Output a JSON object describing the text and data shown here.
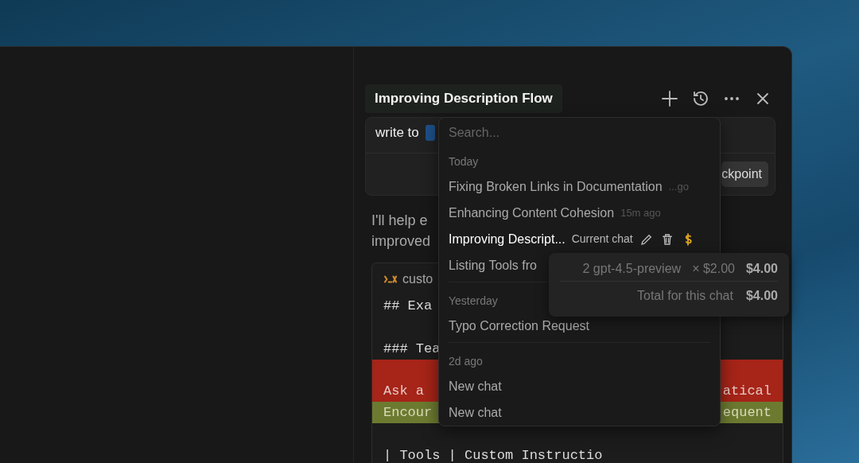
{
  "panel": {
    "title": "Improving Description Flow"
  },
  "message": {
    "text": "write to",
    "checkpoint_button": "ckpoint"
  },
  "reply": {
    "lines": [
      "I'll help e",
      "improved"
    ]
  },
  "code_block": {
    "filename": "custo",
    "lines": [
      {
        "kind": "plain",
        "left": "## Exa"
      },
      {
        "kind": "blank"
      },
      {
        "kind": "plain",
        "left": "### Tea"
      },
      {
        "kind": "removed",
        "left": "Ask a",
        "right": "atical"
      },
      {
        "kind": "added",
        "left": "Encour",
        "right": "equent"
      },
      {
        "kind": "blank"
      },
      {
        "kind": "plain",
        "left": "| Tools | Custom Instructio"
      }
    ]
  },
  "history_menu": {
    "search": {
      "placeholder": "Search..."
    },
    "groups": [
      {
        "label": "Today",
        "items": [
          {
            "title": "Fixing Broken Links in Documentation",
            "time": "...go",
            "selected": false
          },
          {
            "title": "Enhancing Content Cohesion",
            "time": "15m ago",
            "selected": false
          },
          {
            "title": "Improving Descript...",
            "badge": "Current chat",
            "selected": true
          },
          {
            "title": "Listing Tools fro",
            "selected": false
          }
        ]
      },
      {
        "label": "Yesterday",
        "items": [
          {
            "title": "Typo Correction Request",
            "selected": false
          }
        ]
      },
      {
        "label": "2d ago",
        "items": [
          {
            "title": "New chat",
            "selected": false
          },
          {
            "title": "New chat",
            "selected": false
          }
        ]
      }
    ]
  },
  "cost_tooltip": {
    "rows": [
      {
        "count": "2",
        "model": "gpt-4.5-preview",
        "rate": "× $2.00",
        "amount": "$4.00"
      }
    ],
    "total_label": "Total for this chat",
    "total": "$4.00"
  }
}
